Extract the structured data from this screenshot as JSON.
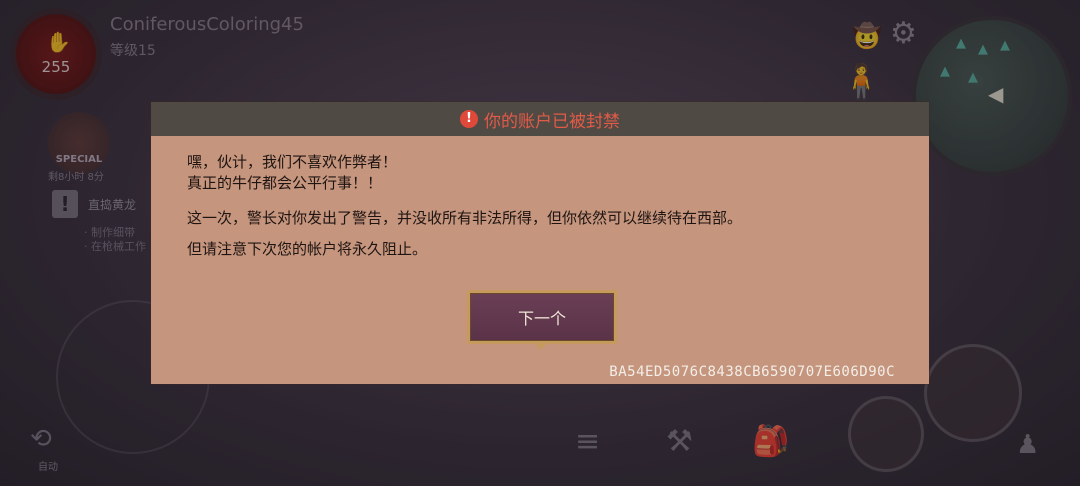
{
  "hud": {
    "player_name": "ConiferousColoring45",
    "level": "等级15",
    "health": "255",
    "special_label": "SPECIAL",
    "special_timer": "剩8小时 8分",
    "quest_title": "直捣黄龙",
    "quest_lines": [
      "· 制作细带",
      "· 在枪械工作"
    ],
    "auto_label": "自动"
  },
  "modal": {
    "title": "你的账户已被封禁",
    "line1": "嘿，伙计，我们不喜欢作弊者！",
    "line2": "真正的牛仔都会公平行事！！",
    "line3": "这一次，警长对你发出了警告，并没收所有非法所得，但你依然可以继续待在西部。",
    "line4": "但请注意下次您的帐户将永久阻止。",
    "next_button": "下一个",
    "ban_code": "BA54ED5076C8438CB6590707E606D90C"
  },
  "colors": {
    "modal_bg": "#c5957d",
    "header_bg": "#504a44",
    "title_red": "#e25a48",
    "button_bg": "#5a3247",
    "button_border": "#c59a5c"
  },
  "icons": [
    "blood-drop-icon",
    "quest-icon",
    "hat-icon",
    "gear-icon",
    "minimap-arrow-icon",
    "rifle-icon",
    "axe-icon",
    "coins-icon",
    "anvil-icon",
    "backpack-icon",
    "sneak-icon",
    "auto-icon"
  ]
}
